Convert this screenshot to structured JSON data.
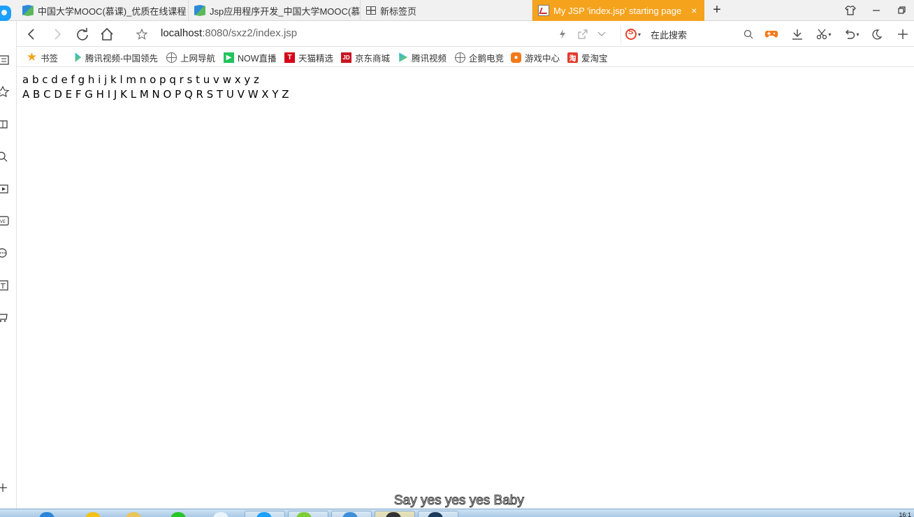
{
  "tabs": [
    {
      "title": "中国大学MOOC(慕课)_优质在线课程",
      "icon": "mooc-icon"
    },
    {
      "title": "Jsp应用程序开发_中国大学MOOC(慕",
      "icon": "mooc-icon"
    },
    {
      "title": "新标签页",
      "icon": "grid-icon"
    },
    {
      "title": "My JSP 'index.jsp' starting page",
      "icon": "jsp-page-icon",
      "active": true,
      "close": "×"
    }
  ],
  "address": {
    "url_host": "localhost",
    "url_rest": ":8080/sxz2/index.jsp",
    "search_placeholder": "在此搜索"
  },
  "bookmarks": [
    {
      "label": "书签",
      "icon": "star-icon"
    },
    {
      "label": "腾讯视频-中国领先",
      "icon": "tencent-video-icon"
    },
    {
      "label": "上网导航",
      "icon": "globe-icon"
    },
    {
      "label": "NOW直播",
      "icon": "now-live-icon"
    },
    {
      "label": "天猫精选",
      "icon": "tmall-icon",
      "glyph": "T"
    },
    {
      "label": "京东商城",
      "icon": "jd-icon",
      "glyph": "JD"
    },
    {
      "label": "腾讯视频",
      "icon": "tencent-video-icon"
    },
    {
      "label": "企鹅电竞",
      "icon": "globe-icon"
    },
    {
      "label": "游戏中心",
      "icon": "game-center-icon"
    },
    {
      "label": "爱淘宝",
      "icon": "taobao-icon",
      "glyph": "淘"
    }
  ],
  "page": {
    "line1": "a b c d e f g h i j k l m n o p q r s t u v w x y z",
    "line2": "A B C D E F G H I J K L M N O P Q R S T U V W X Y Z"
  },
  "overlay": {
    "subtitle": "Say yes yes yes Baby"
  },
  "taskbar": {
    "clock": "16:1"
  },
  "colors": {
    "active_tab": "#f5a21c",
    "brand_blue": "#1aa0ff"
  }
}
